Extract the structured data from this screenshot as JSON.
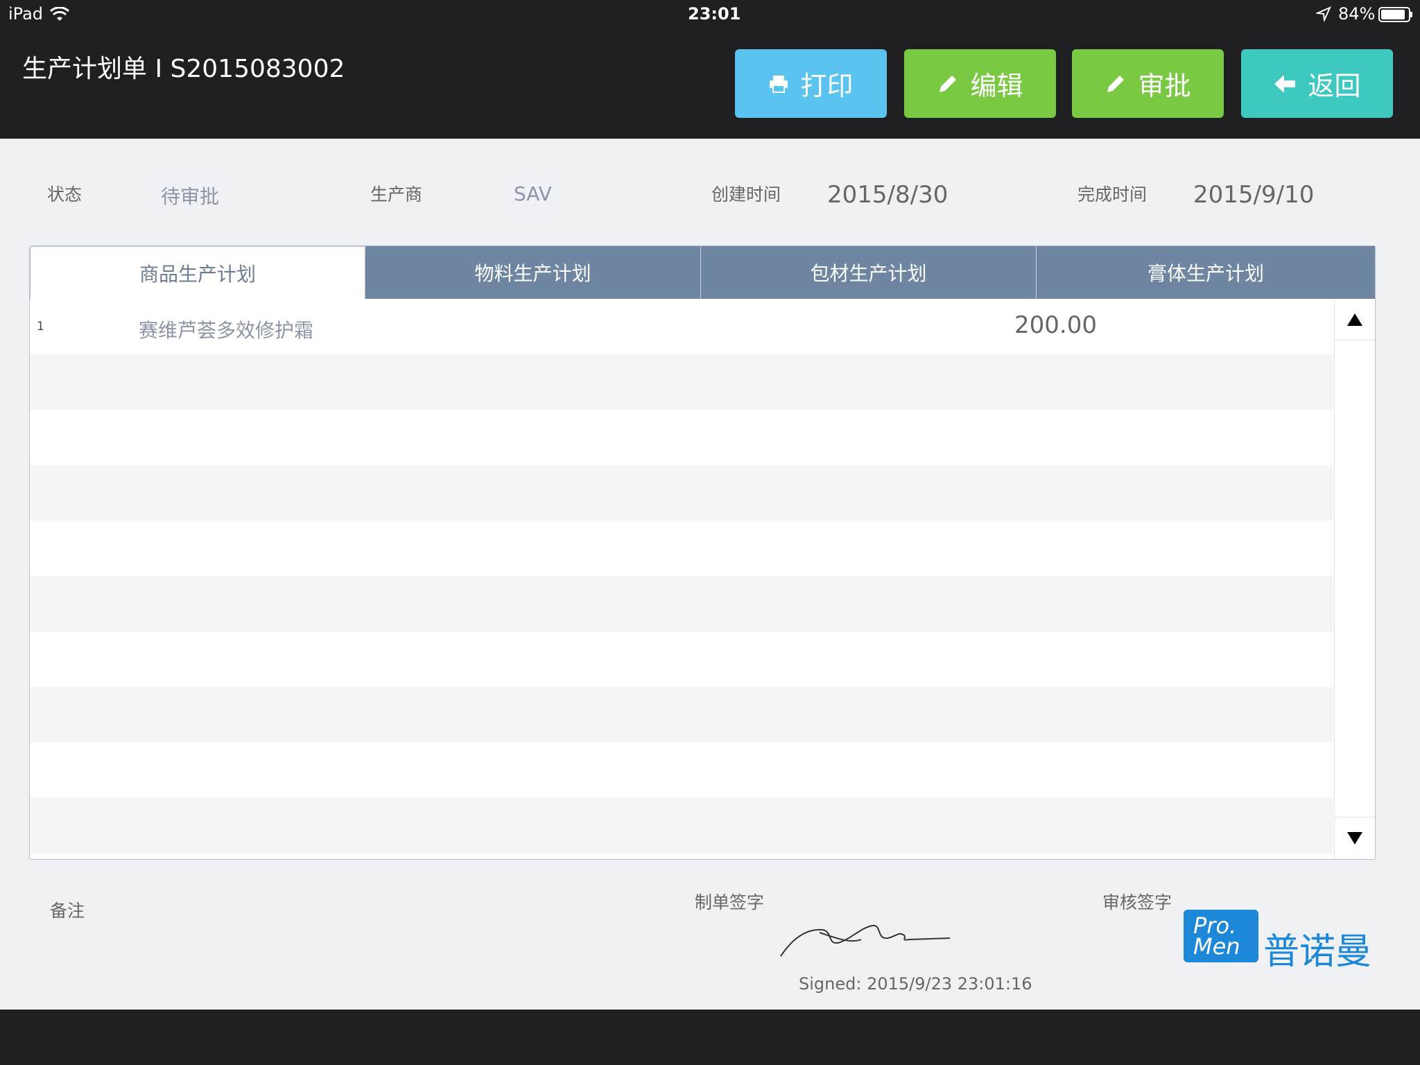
{
  "status_bar": {
    "device": "iPad",
    "time": "23:01",
    "battery": "84%"
  },
  "header": {
    "title": "生产计划单 I S2015083002",
    "buttons": {
      "print": "打印",
      "edit": "编辑",
      "approve": "审批",
      "back": "返回"
    }
  },
  "info": {
    "status_label": "状态",
    "status_value": "待审批",
    "maker_label": "生产商",
    "maker_value": "SAV",
    "created_label": "创建时间",
    "created_value": "2015/8/30",
    "finished_label": "完成时间",
    "finished_value": "2015/9/10"
  },
  "tabs": [
    {
      "label": "商品生产计划",
      "active": true
    },
    {
      "label": "物料生产计划",
      "active": false
    },
    {
      "label": "包材生产计划",
      "active": false
    },
    {
      "label": "膏体生产计划",
      "active": false
    }
  ],
  "table": {
    "rows": [
      {
        "index": "1",
        "name": "赛维芦荟多效修护霜",
        "quantity": "200.00"
      }
    ]
  },
  "footer": {
    "remark_label": "备注",
    "maker_sign_label": "制单签字",
    "reviewer_sign_label": "审核签字",
    "signed_text": "Signed: 2015/9/23 23:01:16",
    "logo_text_en_1": "Pro.",
    "logo_text_en_2": "Men",
    "logo_text_cn": "普诺曼"
  },
  "colors": {
    "topbar": "#1f1f21",
    "print": "#5bc3f0",
    "edit": "#7ac943",
    "approve": "#7ac943",
    "back": "#3ec9c0",
    "tab": "#6f86a3",
    "logo": "#1e88d8"
  },
  "icons": [
    "wifi-icon",
    "location-arrow-icon",
    "battery-icon",
    "printer-icon",
    "pencil-icon",
    "arrow-left-icon",
    "triangle-up-icon",
    "triangle-down-icon",
    "signature-image"
  ]
}
